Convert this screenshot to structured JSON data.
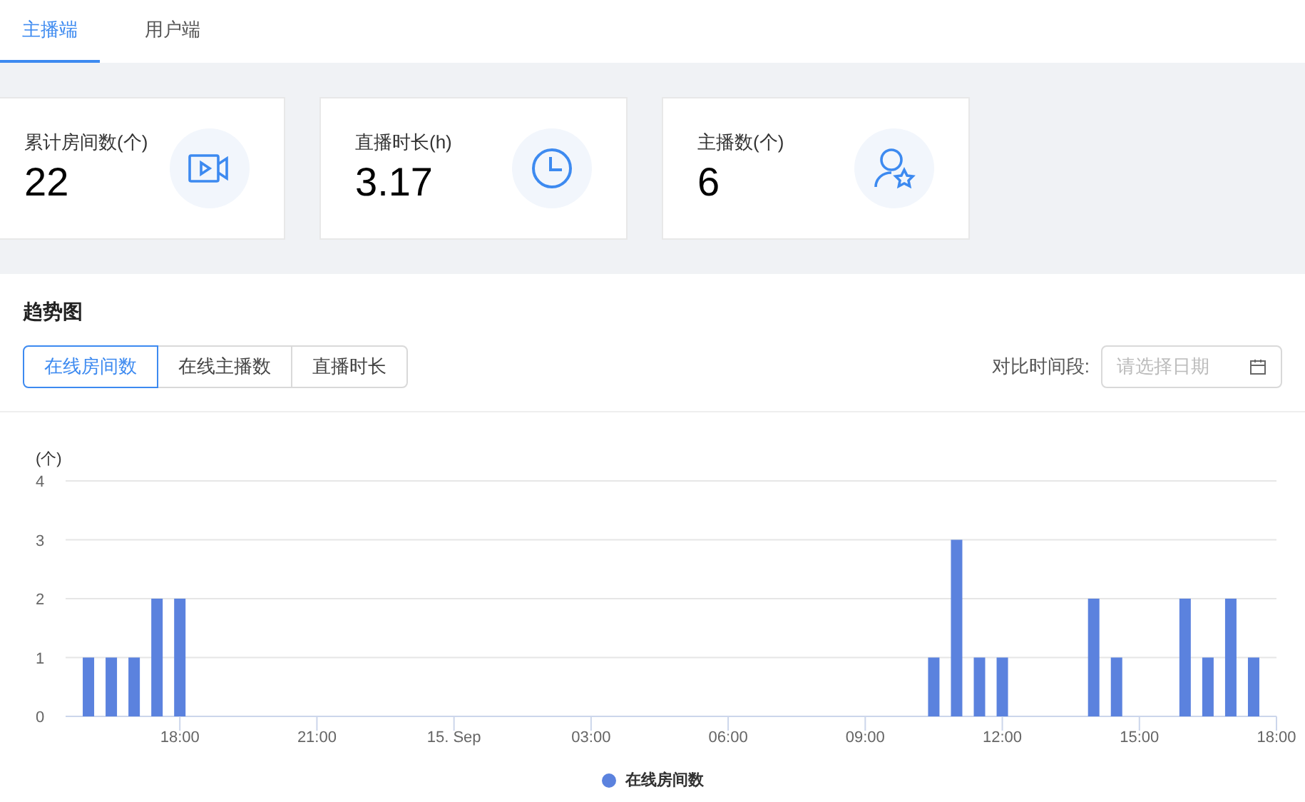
{
  "tabs": [
    {
      "label": "主播端",
      "selected": true
    },
    {
      "label": "用户端",
      "selected": false
    }
  ],
  "stats": [
    {
      "label": "累计房间数(个)",
      "value": "22",
      "kind": "video"
    },
    {
      "label": "直播时长(h)",
      "value": "3.17",
      "kind": "clock"
    },
    {
      "label": "主播数(个)",
      "value": "6",
      "kind": "user-star"
    }
  ],
  "trend": {
    "title": "趋势图",
    "metric_tabs": [
      {
        "label": "在线房间数",
        "selected": true
      },
      {
        "label": "在线主播数",
        "selected": false
      },
      {
        "label": "直播时长",
        "selected": false
      }
    ],
    "compare_label": "对比时间段:",
    "date_field": {
      "placeholder": "请选择日期"
    },
    "chart_data": {
      "type": "bar",
      "ylabel": "(个)",
      "categories": [
        null,
        null,
        null,
        null,
        "18:00",
        null,
        null,
        null,
        null,
        null,
        "21:00",
        null,
        null,
        null,
        null,
        null,
        "15. Sep",
        null,
        null,
        null,
        null,
        null,
        "03:00",
        null,
        null,
        null,
        null,
        null,
        "06:00",
        null,
        null,
        null,
        null,
        null,
        "09:00",
        null,
        null,
        null,
        null,
        null,
        "12:00",
        null,
        null,
        null,
        null,
        null,
        "15:00",
        null,
        null,
        null,
        null,
        null,
        "18:00"
      ],
      "series": [
        {
          "name": "在线房间数",
          "color": "#5b82de",
          "values": [
            1,
            1,
            1,
            2,
            2,
            null,
            null,
            null,
            null,
            null,
            null,
            null,
            null,
            null,
            null,
            null,
            null,
            null,
            null,
            null,
            null,
            null,
            null,
            null,
            null,
            null,
            null,
            null,
            null,
            null,
            null,
            null,
            null,
            null,
            null,
            null,
            null,
            1,
            3,
            1,
            1,
            null,
            null,
            null,
            2,
            1,
            null,
            null,
            2,
            1,
            2,
            1,
            null
          ]
        }
      ],
      "ylim": [
        0,
        4
      ],
      "yticks": [
        0,
        1,
        2,
        3,
        4
      ],
      "grid": true
    }
  }
}
